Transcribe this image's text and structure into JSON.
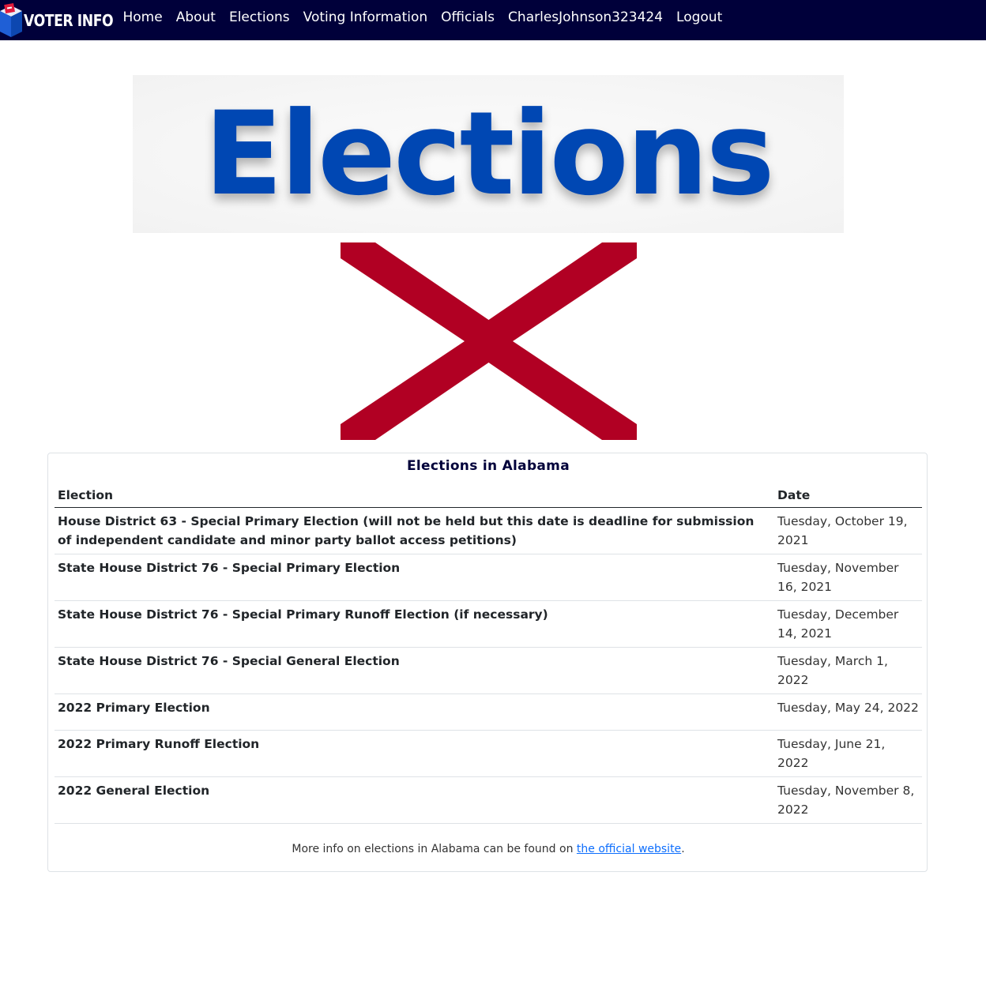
{
  "navbar": {
    "brand_text": "VOTER INFO",
    "links": [
      "Home",
      "About",
      "Elections",
      "Voting Information",
      "Officials",
      "CharlesJohnson323424",
      "Logout"
    ]
  },
  "banner": {
    "title": "Elections",
    "title_color": "#0047b3"
  },
  "flag": {
    "icon": "alabama-flag",
    "cross_color": "#b10023"
  },
  "elections_card": {
    "title": "Elections in Alabama",
    "columns": [
      "Election",
      "Date"
    ],
    "rows": [
      {
        "name": "House District 63 - Special Primary Election (will not be held but this date is deadline for submission of independent candidate and minor party ballot access petitions)",
        "date": "Tuesday, October 19, 2021"
      },
      {
        "name": "State House District 76 - Special Primary Election",
        "date": "Tuesday, November 16, 2021"
      },
      {
        "name": "State House District 76 - Special Primary Runoff Election (if necessary)",
        "date": "Tuesday, December 14, 2021"
      },
      {
        "name": "State House District 76 - Special General Election",
        "date": "Tuesday, March 1, 2022"
      },
      {
        "name": "2022 Primary Election",
        "date": "Tuesday, May 24, 2022"
      },
      {
        "name": "2022 Primary Runoff Election",
        "date": "Tuesday, June 21, 2022"
      },
      {
        "name": "2022 General Election",
        "date": "Tuesday, November 8, 2022"
      }
    ],
    "footer_prefix": "More info on elections in Alabama can be found on ",
    "footer_link": "the official website",
    "footer_suffix": "."
  },
  "colors": {
    "navbar_bg": "#00003a",
    "link": "#0d6efd"
  }
}
